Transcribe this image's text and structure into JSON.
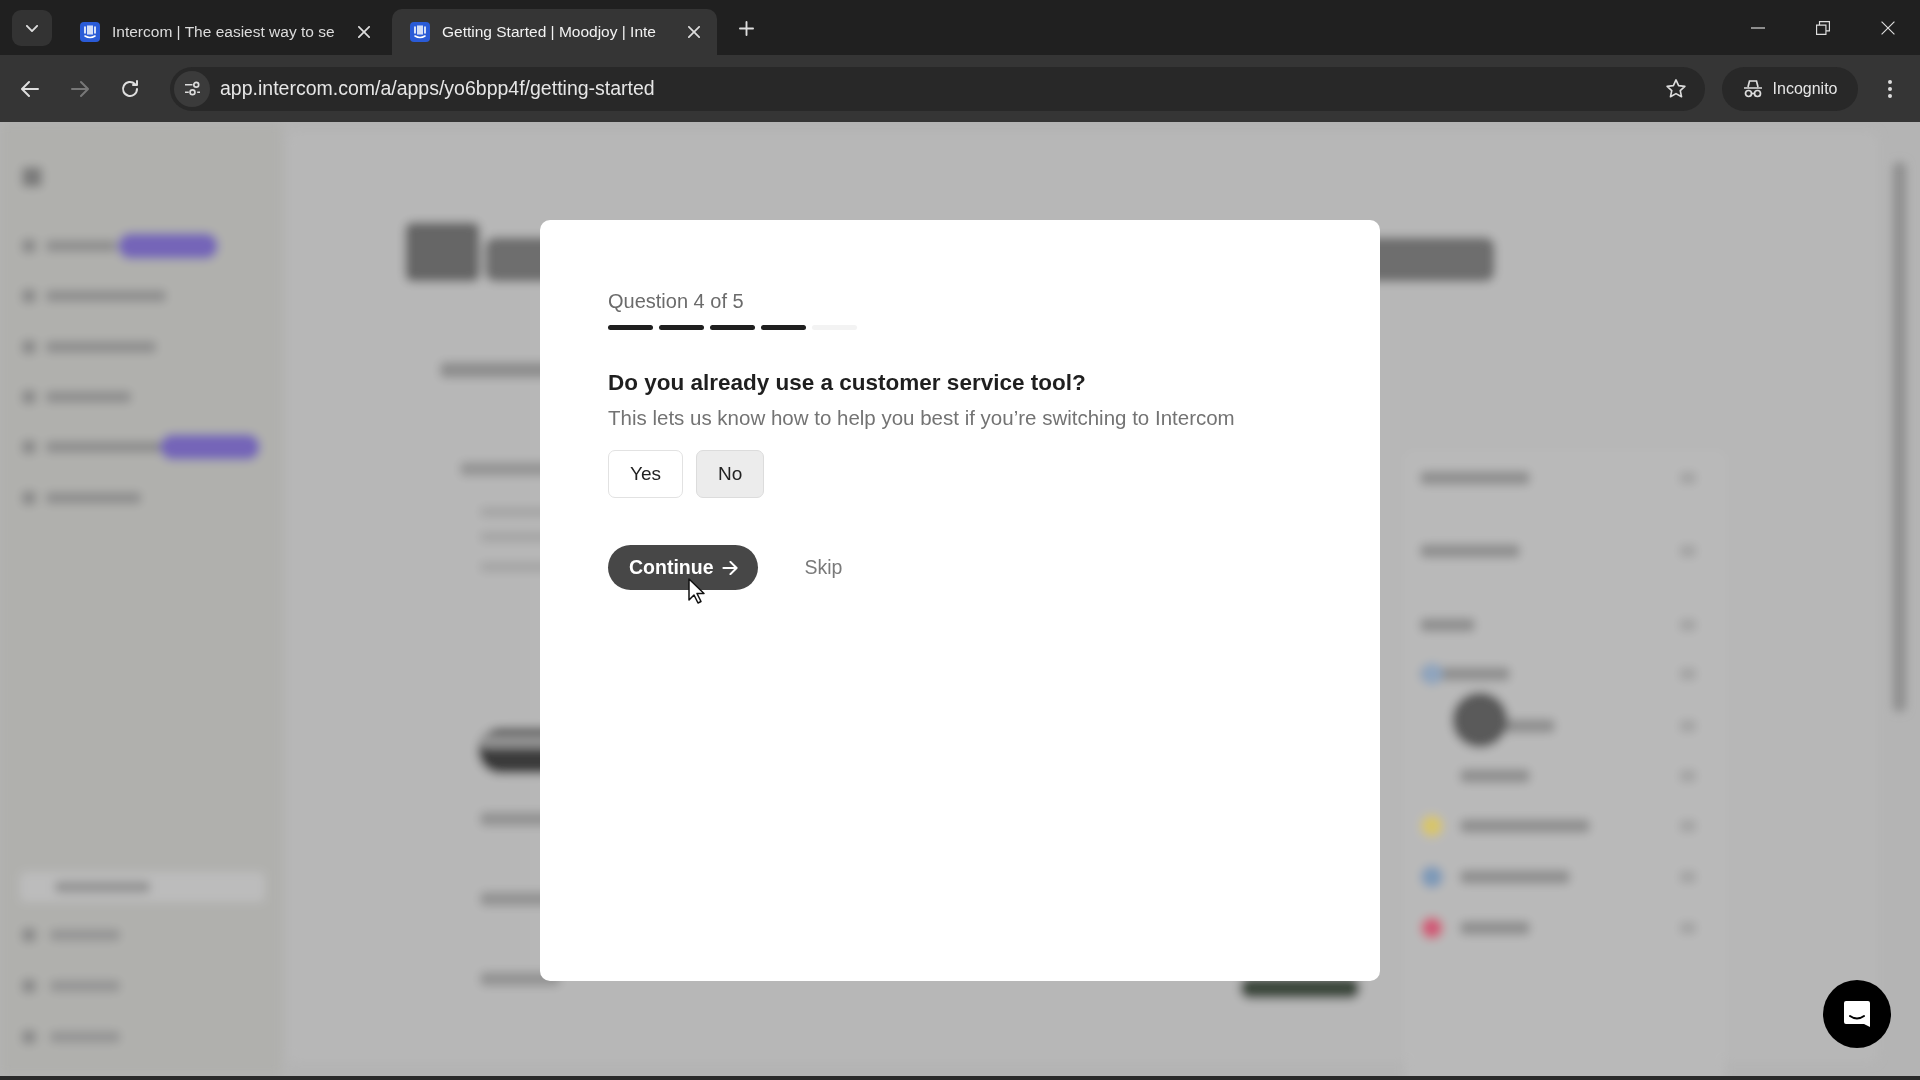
{
  "browser": {
    "tabs": [
      {
        "title": "Intercom | The easiest way to se",
        "selected": false
      },
      {
        "title": "Getting Started | Moodjoy | Inte",
        "selected": true
      }
    ],
    "forward_disabled": true,
    "address": "app.intercom.com/a/apps/yo6bpp4f/getting-started",
    "profile": "Incognito"
  },
  "dialog": {
    "progress_label": "Question 4 of 5",
    "steps": [
      {
        "done": true
      },
      {
        "done": true
      },
      {
        "done": true
      },
      {
        "done": true
      },
      {
        "done": false
      }
    ],
    "question": "Do you already use a customer service tool?",
    "hint": "This lets us know how to help you best if you’re switching to Intercom",
    "options": [
      {
        "label": "Yes",
        "highlighted": false
      },
      {
        "label": "No",
        "highlighted": true
      }
    ],
    "continue": "Continue",
    "skip": "Skip"
  }
}
